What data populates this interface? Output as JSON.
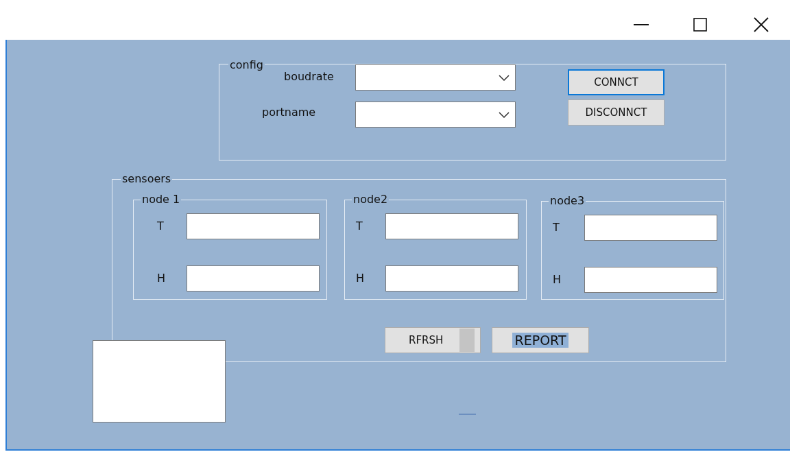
{
  "config": {
    "title": "config",
    "fields": [
      {
        "label": "boudrate"
      },
      {
        "label": "portname"
      }
    ],
    "buttons": [
      {
        "label": "CONNCT",
        "focused": true
      },
      {
        "label": "DISCONNCT",
        "focused": false
      }
    ]
  },
  "sensors": {
    "title": "sensoers",
    "nodes": [
      {
        "title": "node 1",
        "fields": [
          {
            "label": "T"
          },
          {
            "label": "H"
          }
        ]
      },
      {
        "title": "node2",
        "fields": [
          {
            "label": "T"
          },
          {
            "label": "H"
          }
        ]
      },
      {
        "title": "node3",
        "fields": [
          {
            "label": "T"
          },
          {
            "label": "H"
          }
        ]
      }
    ],
    "buttons": [
      {
        "label": "RFRSH",
        "highlighted": false
      },
      {
        "label": "REPORT",
        "highlighted": true
      }
    ]
  }
}
